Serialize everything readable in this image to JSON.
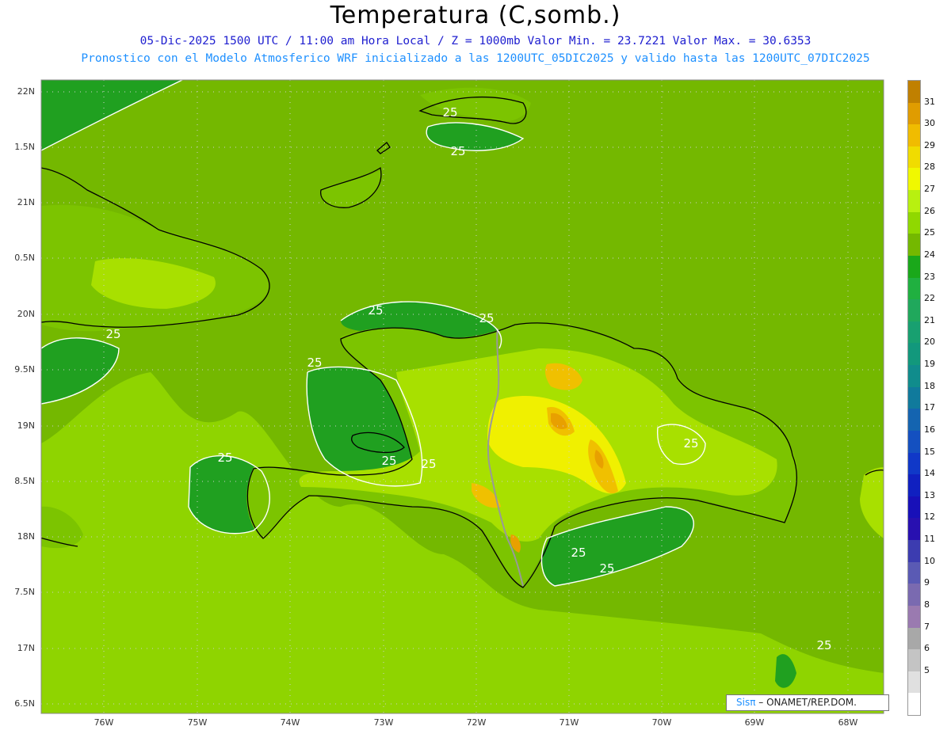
{
  "header": {
    "title": "Temperatura (C,somb.)",
    "line1": "05-Dic-2025 1500 UTC / 11:00 am Hora Local / Z = 1000mb  Valor Min. = 23.7221  Valor Max. = 30.6353",
    "line2": "Pronostico con el Modelo Atmosferico WRF inicializado a las 1200UTC_05DIC2025 y valido hasta las  1200UTC_07DIC2025"
  },
  "map": {
    "lat_ticks": [
      "22N",
      "1.5N",
      "21N",
      "0.5N",
      "20N",
      "9.5N",
      "19N",
      "8.5N",
      "18N",
      "7.5N",
      "17N",
      "6.5N"
    ],
    "lon_ticks": [
      "76W",
      "75W",
      "74W",
      "73W",
      "72W",
      "71W",
      "70W",
      "69W",
      "68W"
    ],
    "contour_labels": [
      "25",
      "25",
      "25",
      "25",
      "25",
      "25",
      "25",
      "25",
      "25",
      "25",
      "25",
      "25",
      "25"
    ],
    "colors": {
      "sea_cool": "#74b800",
      "sea_warm": "#8fd400",
      "cool_patch": "#20a020",
      "land_base": "#7cc400",
      "land_warm": "#a8e000",
      "land_hot": "#f0f000",
      "land_hotter": "#f0c000",
      "land_hottest": "#e8a000",
      "coast": "#000000",
      "border": "#999999",
      "contour": "#ffffff",
      "grid": "#cfcfcf"
    }
  },
  "colorbar": {
    "labels": [
      "31",
      "30",
      "29",
      "28",
      "27",
      "26",
      "25",
      "24",
      "23",
      "22",
      "21",
      "20",
      "19",
      "18",
      "17",
      "16",
      "15",
      "14",
      "13",
      "12",
      "11",
      "10",
      "9",
      "8",
      "7",
      "6",
      "5"
    ],
    "colors": [
      "#c08000",
      "#e09c00",
      "#f0bc00",
      "#f0dc00",
      "#f0f800",
      "#b8f010",
      "#90d800",
      "#74b800",
      "#1aa81a",
      "#20b040",
      "#20a85c",
      "#18a070",
      "#12987c",
      "#108c8c",
      "#107a9c",
      "#1464b0",
      "#1450c0",
      "#1038c8",
      "#1020c0",
      "#1810b8",
      "#2810b0",
      "#3c3cb0",
      "#5a5ab4",
      "#7a6ab0",
      "#9a7ab0",
      "#a8a8a8",
      "#c4c4c4",
      "#e0e0e0",
      "#ffffff"
    ]
  },
  "brand": {
    "sis": "Sisπ",
    "org": "– ONAMET/REP.DOM."
  }
}
